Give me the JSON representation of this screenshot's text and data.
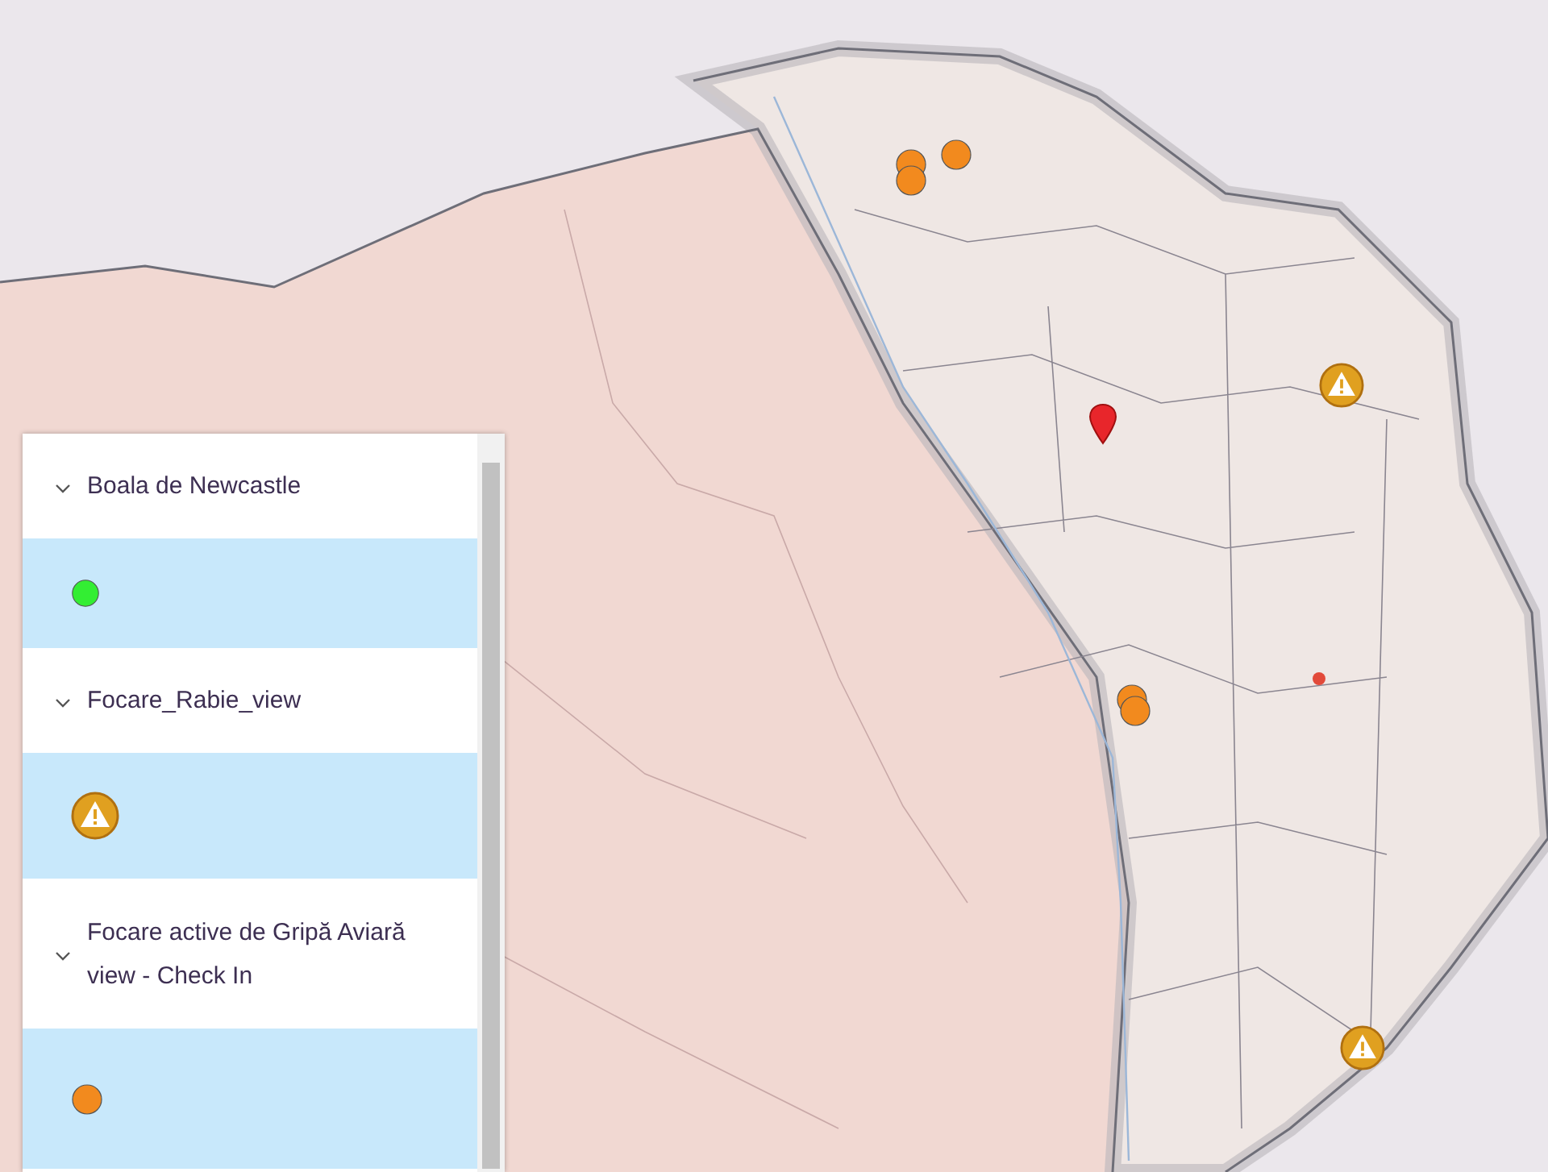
{
  "legend": {
    "layers": [
      {
        "title": "Boala de Newcastle",
        "expanded": true,
        "symbol": {
          "kind": "dot",
          "color": "#33ee33"
        }
      },
      {
        "title": "Focare_Rabie_view",
        "expanded": true,
        "symbol": {
          "kind": "warning",
          "color": "#e0a020"
        }
      },
      {
        "title": "Focare active de Gripă Aviară view - Check In",
        "expanded": true,
        "symbol": {
          "kind": "dot",
          "color": "#f28a1e"
        }
      }
    ]
  }
}
